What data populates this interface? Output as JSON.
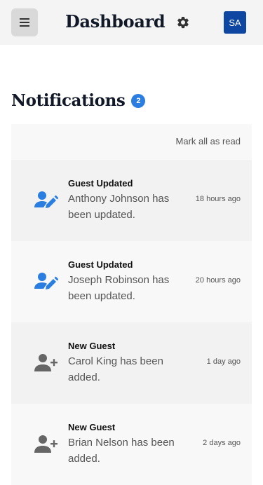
{
  "header": {
    "title": "Dashboard",
    "avatar_initials": "SA",
    "menu_icon": "hamburger-icon",
    "settings_icon": "gear-icon"
  },
  "notifications": {
    "title": "Notifications",
    "count": "2",
    "mark_all_label": "Mark all as read",
    "items": [
      {
        "heading": "Guest Updated",
        "text": "Anthony Johnson has been updated.",
        "time": "18 hours ago",
        "icon": "user-edit-icon",
        "icon_color": "#2a7de1"
      },
      {
        "heading": "Guest Updated",
        "text": "Joseph Robinson has been updated.",
        "time": "20 hours ago",
        "icon": "user-edit-icon",
        "icon_color": "#2a7de1"
      },
      {
        "heading": "New Guest",
        "text": "Carol King has been added.",
        "time": "1 day ago",
        "icon": "user-add-icon",
        "icon_color": "#666666"
      },
      {
        "heading": "New Guest",
        "text": "Brian Nelson has been added.",
        "time": "2 days ago",
        "icon": "user-add-icon",
        "icon_color": "#666666"
      }
    ]
  },
  "colors": {
    "accent": "#2a7de1",
    "avatar_bg": "#0d47a1",
    "topbar_bg": "#f4f4f4"
  }
}
